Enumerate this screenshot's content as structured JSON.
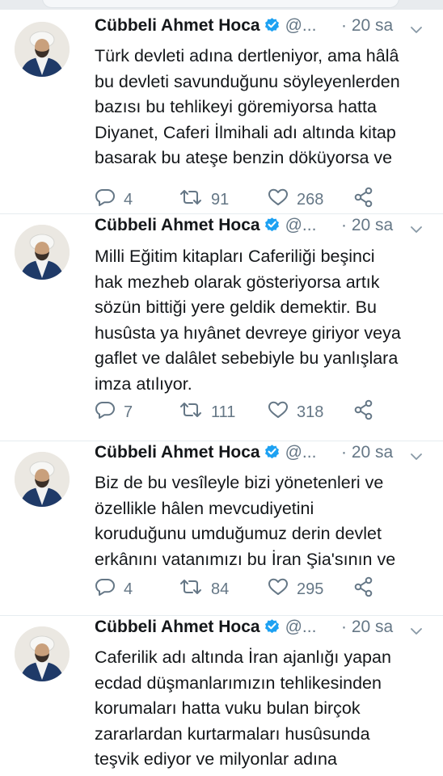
{
  "author": {
    "name": "Cübbeli Ahmet Hoca",
    "handle": "@...",
    "time": "· 20 sa"
  },
  "icons": {
    "verified": "verified-badge-icon",
    "more": "chevron-down-icon",
    "reply": "reply-icon",
    "retweet": "retweet-icon",
    "like": "heart-icon",
    "share": "share-icon"
  },
  "colors": {
    "verified": "#1da1f2",
    "muted": "#657786",
    "text": "#14171a"
  },
  "tweets": [
    {
      "lines": [
        "Türk devleti adına dertleniyor, ama hâlâ",
        "bu devleti savunduğunu söyleyenlerden",
        "bazısı bu tehlikeyi göremiyorsa hatta",
        "Diyanet, Caferi İlmihali adı altında kitap",
        "basarak bu ateşe benzin döküyorsa ve"
      ],
      "replies": "4",
      "retweets": "91",
      "likes": "268"
    },
    {
      "lines": [
        "Milli Eğitim kitapları Caferiliği beşinci",
        "hak mezheb olarak gösteriyorsa artık",
        "sözün bittiği yere geldik demektir. Bu",
        "husûsta ya hıyânet devreye giriyor veya",
        "gaflet ve dalâlet sebebiyle bu yanlışlara",
        "imza atılıyor."
      ],
      "replies": "7",
      "retweets": "111",
      "likes": "318"
    },
    {
      "lines": [
        "Biz de bu vesîleyle bizi yönetenleri ve",
        "özellikle hâlen mevcudiyetini",
        "koruduğunu umduğumuz derin devlet",
        "erkânını vatanımızı bu İran Şia'sının ve"
      ],
      "replies": "4",
      "retweets": "84",
      "likes": "295"
    },
    {
      "lines": [
        "Caferilik adı altında İran ajanlığı yapan",
        "ecdad düşmanlarımızın tehlikesinden",
        "korumaları hatta vuku bulan birçok",
        "zararlardan kurtarmaları husûsunda",
        "teşvik ediyor ve milyonlar adına"
      ]
    }
  ]
}
